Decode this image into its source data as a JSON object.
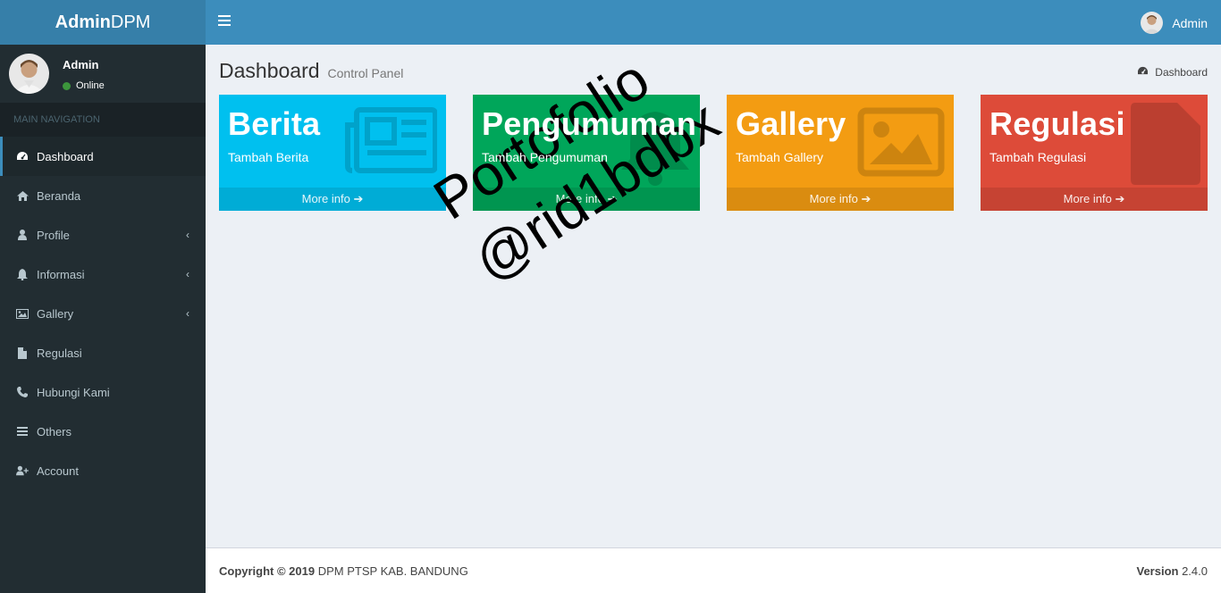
{
  "app": {
    "logo_bold": "Admin",
    "logo_rest": "DPM"
  },
  "header": {
    "user_name": "Admin"
  },
  "sidebar": {
    "user_name": "Admin",
    "user_status": "Online",
    "nav_header": "MAIN NAVIGATION",
    "items": [
      {
        "label": "Dashboard",
        "icon": "dashboard-icon"
      },
      {
        "label": "Beranda",
        "icon": "home-icon"
      },
      {
        "label": "Profile",
        "icon": "user-icon"
      },
      {
        "label": "Informasi",
        "icon": "bell-icon"
      },
      {
        "label": "Gallery",
        "icon": "image-icon"
      },
      {
        "label": "Regulasi",
        "icon": "file-icon"
      },
      {
        "label": "Hubungi Kami",
        "icon": "phone-icon"
      },
      {
        "label": "Others",
        "icon": "bars-icon"
      },
      {
        "label": "Account",
        "icon": "user-plus-icon"
      }
    ]
  },
  "content": {
    "title": "Dashboard",
    "subtitle": "Control Panel",
    "breadcrumb": "Dashboard"
  },
  "boxes": [
    {
      "title": "Berita",
      "subtitle": "Tambah Berita",
      "link": "More info",
      "color": "#00c0ef",
      "icon": "newspaper-icon"
    },
    {
      "title": "Pengumuman",
      "subtitle": "Tambah Pengumuman",
      "link": "More info",
      "color": "#00a65a",
      "icon": "bell-icon"
    },
    {
      "title": "Gallery",
      "subtitle": "Tambah Gallery",
      "link": "More info",
      "color": "#f39c12",
      "icon": "image-icon"
    },
    {
      "title": "Regulasi",
      "subtitle": "Tambah Regulasi",
      "link": "More info",
      "color": "#dd4b39",
      "icon": "file-icon"
    }
  ],
  "footer": {
    "copyright_bold": "Copyright © 2019",
    "copyright_rest": "DPM PTSP KAB. BANDUNG",
    "version_label": "Version",
    "version_number": "2.4.0"
  },
  "watermark": {
    "line1": "Portofolio",
    "line2": "@rid1bdbx"
  }
}
